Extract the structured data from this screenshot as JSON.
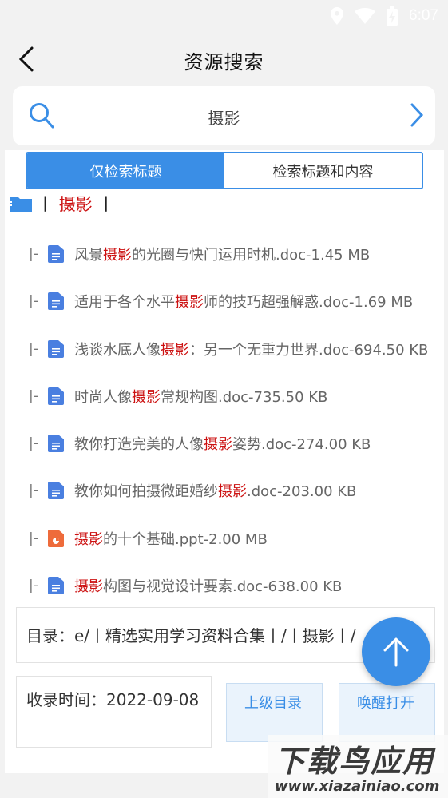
{
  "status": {
    "time": "6:07"
  },
  "header": {
    "title": "资源搜索"
  },
  "search": {
    "value": "摄影"
  },
  "toggle": {
    "option1": "仅检索标题",
    "option2": "检索标题和内容"
  },
  "folder": {
    "prefix": "丨",
    "name": "摄影",
    "suffix": "丨"
  },
  "file_prefix": "|-",
  "files": [
    {
      "pre": "风景",
      "hl": "摄影",
      "post": "的光圈与快门运用时机.doc-1.45 MB",
      "type": "doc"
    },
    {
      "pre": "适用于各个水平",
      "hl": "摄影",
      "post": "师的技巧超强解惑.doc-1.69 MB",
      "type": "doc"
    },
    {
      "pre": "浅谈水底人像",
      "hl": "摄影",
      "post": "：另一个无重力世界.doc-694.50 KB",
      "type": "doc"
    },
    {
      "pre": "时尚人像",
      "hl": "摄影",
      "post": "常规构图.doc-735.50 KB",
      "type": "doc"
    },
    {
      "pre": "教你打造完美的人像",
      "hl": "摄影",
      "post": "姿势.doc-274.00 KB",
      "type": "doc"
    },
    {
      "pre": "教你如何拍摄微距婚纱",
      "hl": "摄影",
      "post": ".doc-203.00 KB",
      "type": "doc"
    },
    {
      "pre": "",
      "hl": "摄影",
      "post": "的十个基础.ppt-2.00 MB",
      "type": "ppt"
    },
    {
      "pre": "",
      "hl": "摄影",
      "post": "构图与视觉设计要素.doc-638.00 KB",
      "type": "doc"
    }
  ],
  "path": {
    "text": "目录：e/丨精选实用学习资料合集丨/丨摄影丨/"
  },
  "record": {
    "text": "收录时间：2022-09-08"
  },
  "buttons": {
    "parent_dir": "上级目录",
    "wake_open": "唤醒打开"
  },
  "watermark": {
    "main": "下载鸟应用",
    "url": "www.xiazainiao.com"
  },
  "colors": {
    "accent": "#3a8ee6",
    "highlight": "#cc1111",
    "doc_icon": "#4a7fe0",
    "ppt_icon": "#ee6b3b"
  }
}
